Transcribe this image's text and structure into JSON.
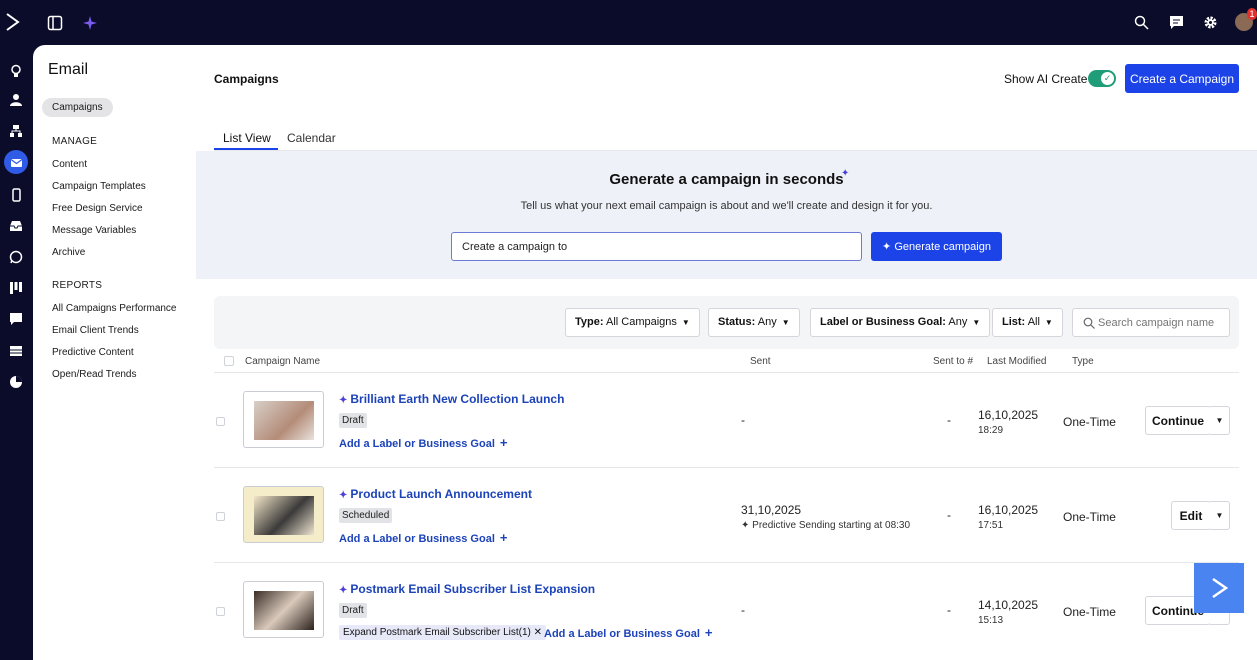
{
  "top_bar": {
    "icons": [
      "logo-icon",
      "panel-toggle-icon",
      "ai-sparkle-icon",
      "search-icon",
      "chat-icon",
      "gear-icon",
      "avatar"
    ],
    "notification_count": "1"
  },
  "rail": {
    "icons": [
      "lightbulb-icon",
      "contacts-icon",
      "org-chart-icon",
      "email-icon",
      "mobile-icon",
      "inbox-icon",
      "whatsapp-icon",
      "kanban-icon",
      "message-icon",
      "table-icon",
      "reports-pie-icon"
    ],
    "active": "email-icon"
  },
  "sidebar": {
    "title": "Email",
    "active_pill": "Campaigns",
    "manage_heading": "MANAGE",
    "manage_items": [
      "Content",
      "Campaign Templates",
      "Free Design Service",
      "Message Variables",
      "Archive"
    ],
    "reports_heading": "REPORTS",
    "report_items": [
      "All Campaigns Performance",
      "Email Client Trends",
      "Predictive Content",
      "Open/Read Trends"
    ]
  },
  "header": {
    "title": "Campaigns",
    "ai_toggle_label": "Show AI Create",
    "ai_toggle_on": true,
    "create_button": "Create a Campaign"
  },
  "tabs": [
    {
      "label": "List View",
      "active": true
    },
    {
      "label": "Calendar",
      "active": false
    }
  ],
  "hero": {
    "title": "Generate a campaign in seconds",
    "subtitle": "Tell us what your next email campaign is about and we'll create and design it for you.",
    "input_value": "Create a campaign to",
    "generate_button": "Generate campaign"
  },
  "filters": {
    "type": {
      "label": "Type:",
      "value": "All Campaigns"
    },
    "status": {
      "label": "Status:",
      "value": "Any"
    },
    "goal": {
      "label": "Label or Business Goal:",
      "value": "Any"
    },
    "list": {
      "label": "List:",
      "value": "All"
    },
    "search_placeholder": "Search campaign name"
  },
  "table": {
    "columns": [
      "Campaign Name",
      "Sent",
      "Sent to #",
      "Last Modified",
      "Type"
    ],
    "rows": [
      {
        "name": "Brilliant Earth New Collection Launch",
        "status": "Draft",
        "label_link": "Add a Label or Business Goal",
        "sent": "-",
        "sent_to": "-",
        "modified_date": "16,10,2025",
        "modified_time": "18:29",
        "type": "One-Time",
        "action": "Continue"
      },
      {
        "name": "Product Launch Announcement",
        "status": "Scheduled",
        "label_link": "Add a Label or Business Goal",
        "sent": "31,10,2025",
        "sent_note": "Predictive Sending starting at 08:30",
        "sent_to": "-",
        "modified_date": "16,10,2025",
        "modified_time": "17:51",
        "type": "One-Time",
        "action": "Edit"
      },
      {
        "name": "Postmark Email Subscriber List Expansion",
        "status": "Draft",
        "chip": "Expand Postmark Email Subscriber List(1)",
        "label_link": "Add a Label or Business Goal",
        "sent": "-",
        "sent_to": "-",
        "modified_date": "14,10,2025",
        "modified_time": "15:13",
        "type": "One-Time",
        "action": "Continue"
      }
    ]
  },
  "colors": {
    "nav_bg": "#0b0c2a",
    "primary": "#1c43e8",
    "link": "#1c43b8",
    "toggle_on": "#1f9d78",
    "hero_bg": "#eef1f8"
  }
}
